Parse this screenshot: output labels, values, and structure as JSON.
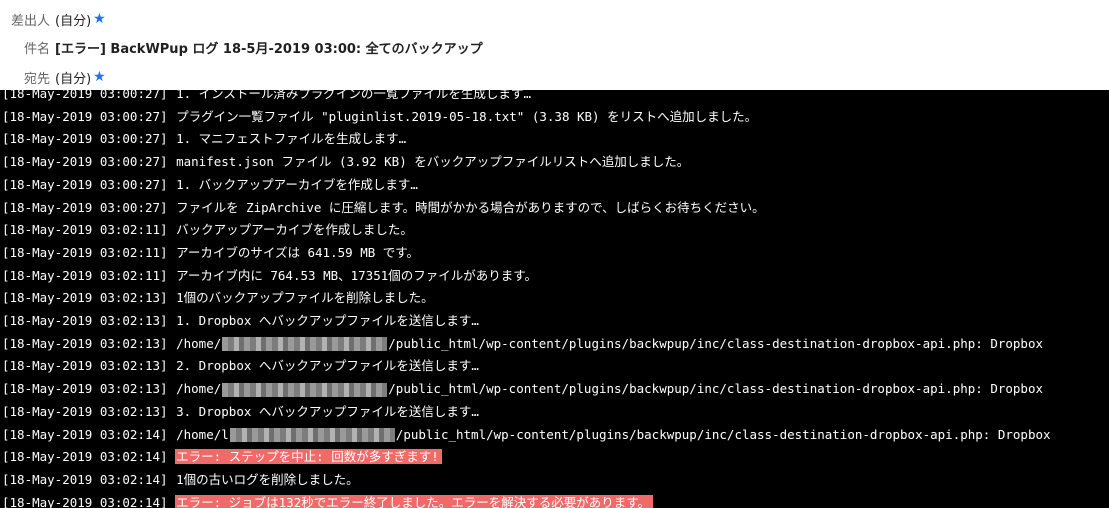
{
  "email": {
    "from_label": "差出人",
    "from_value": "(自分)",
    "subject_label": "件名",
    "subject_value": "[エラー] BackWPup ログ 18-5月-2019 03:00: 全てのバックアップ",
    "to_label": "宛先",
    "to_value": "(自分)"
  },
  "log": {
    "lines": [
      {
        "ts": "[18-May-2019 03:00:27]",
        "pre": "1. インストール済みプラグインの一覧ファイルを生成します…",
        "post": "",
        "error": false
      },
      {
        "ts": "[18-May-2019 03:00:27]",
        "pre": "プラグイン一覧ファイル \"pluginlist.2019-05-18.txt\" (3.38 KB) をリストへ追加しました。",
        "post": "",
        "error": false
      },
      {
        "ts": "[18-May-2019 03:00:27]",
        "pre": "1. マニフェストファイルを生成します…",
        "post": "",
        "error": false
      },
      {
        "ts": "[18-May-2019 03:00:27]",
        "pre": "manifest.json ファイル (3.92 KB) をバックアップファイルリストへ追加しました。",
        "post": "",
        "error": false
      },
      {
        "ts": "[18-May-2019 03:00:27]",
        "pre": "1. バックアップアーカイブを作成します…",
        "post": "",
        "error": false
      },
      {
        "ts": "[18-May-2019 03:00:27]",
        "pre": "ファイルを ZipArchive に圧縮します。時間がかかる場合がありますので、しばらくお待ちください。",
        "post": "",
        "error": false
      },
      {
        "ts": "[18-May-2019 03:02:11]",
        "pre": "バックアップアーカイブを作成しました。",
        "post": "",
        "error": false
      },
      {
        "ts": "[18-May-2019 03:02:11]",
        "pre": "アーカイブのサイズは 641.59 MB です。",
        "post": "",
        "error": false
      },
      {
        "ts": "[18-May-2019 03:02:11]",
        "pre": "アーカイブ内に 764.53 MB、17351個のファイルがあります。",
        "post": "",
        "error": false
      },
      {
        "ts": "[18-May-2019 03:02:13]",
        "pre": "1個のバックアップファイルを削除しました。",
        "post": "",
        "error": false
      },
      {
        "ts": "[18-May-2019 03:02:13]",
        "pre": "1. Dropbox へバックアップファイルを送信します…",
        "post": "",
        "error": false
      },
      {
        "ts": "[18-May-2019 03:02:13]",
        "pre": "/home/",
        "post": "/public_html/wp-content/plugins/backwpup/inc/class-destination-dropbox-api.php: Dropbox",
        "error": false
      },
      {
        "ts": "[18-May-2019 03:02:13]",
        "pre": "2. Dropbox へバックアップファイルを送信します…",
        "post": "",
        "error": false
      },
      {
        "ts": "[18-May-2019 03:02:13]",
        "pre": "/home/",
        "post": "/public_html/wp-content/plugins/backwpup/inc/class-destination-dropbox-api.php: Dropbox",
        "error": false
      },
      {
        "ts": "[18-May-2019 03:02:13]",
        "pre": "3. Dropbox へバックアップファイルを送信します…",
        "post": "",
        "error": false
      },
      {
        "ts": "[18-May-2019 03:02:14]",
        "pre": "/home/l",
        "post": "/public_html/wp-content/plugins/backwpup/inc/class-destination-dropbox-api.php: Dropbox",
        "error": false
      },
      {
        "ts": "[18-May-2019 03:02:14]",
        "pre": "エラー: ステップを中止: 回数が多すぎます!",
        "post": "",
        "error": true
      },
      {
        "ts": "[18-May-2019 03:02:14]",
        "pre": "1個の古いログを削除しました。",
        "post": "",
        "error": false
      },
      {
        "ts": "[18-May-2019 03:02:14]",
        "pre": "エラー: ジョブは132秒でエラー終了しました。エラーを解決する必要があります。",
        "post": "",
        "error": true
      }
    ]
  }
}
